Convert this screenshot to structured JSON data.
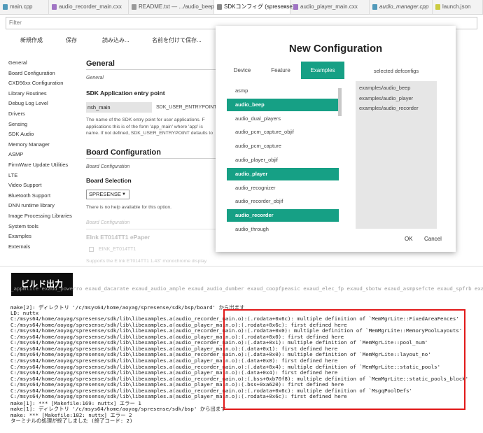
{
  "tabs": [
    {
      "label": "main.cpp",
      "icon": "cpp-file-icon",
      "color": "#519aba"
    },
    {
      "label": "audio_recorder_main.cxx",
      "icon": "cxx-file-icon",
      "color": "#a074c4"
    },
    {
      "label": "README.txt — .../audio_beep",
      "icon": "text-file-icon",
      "color": "#999999"
    },
    {
      "label": "SDKコンフィグ (spresense)",
      "icon": "config-icon",
      "color": "#888888"
    },
    {
      "label": "audio_player_main.cxx",
      "icon": "cxx-file-icon",
      "color": "#a074c4"
    },
    {
      "label": "audio_manager.cpp",
      "icon": "cpp-file-icon",
      "color": "#519aba"
    },
    {
      "label": "launch.json",
      "icon": "json-file-icon",
      "color": "#cbcb41"
    }
  ],
  "filter": {
    "placeholder": "Filter"
  },
  "toolbar": {
    "new": "新規作成",
    "save": "保存",
    "load": "読み込み...",
    "save_as": "名前を付けて保存..."
  },
  "menu": [
    "General",
    "Board Configuration",
    "CXD56xx Configuration",
    "Library Routines",
    "Debug Log Level",
    "Drivers",
    "Sensing",
    "SDK Audio",
    "Memory Manager",
    "ASMP",
    "FirmWare Update Utilities",
    "LTE",
    "Video Support",
    "Bluetooth Support",
    "DNN runtime library",
    "Image Processing Libraries",
    "System tools",
    "Examples",
    "Externals"
  ],
  "content": {
    "general_title": "General",
    "general_sub": "General",
    "entry_title": "SDK Application entry point",
    "entry_value": "nsh_main",
    "entry_key": "SDK_USER_ENTRYPOINT",
    "entry_desc1": "The name of the SDK entry point for user applications. F",
    "entry_desc2": "applications this is of the form 'app_main' where 'app' is",
    "entry_desc3": "name. If not defined, SDK_USER_ENTRYPOINT defaults to",
    "board_title": "Board Configuration",
    "board_sub": "Board Configuration",
    "board_sel_title": "Board Selection",
    "board_sel_value": "SPRESENSE",
    "board_help": "There is no help available for this option.",
    "board_sub2": "Board Configuration",
    "eink_title": "EInk ET014TT1 ePaper",
    "eink_key": "EINK_ET014TT1",
    "eink_desc": "Supports the E Ink ET014TT1 1.43\" monochrome display."
  },
  "modal": {
    "title": "New Configuration",
    "tabs": [
      "Device",
      "Feature",
      "Examples"
    ],
    "active_tab": "Examples",
    "selected_header": "selected defconfigs",
    "list": [
      {
        "label": "asmp",
        "selected": false
      },
      {
        "label": "audio_beep",
        "selected": true
      },
      {
        "label": "audio_dual_players",
        "selected": false
      },
      {
        "label": "audio_pcm_capture_objif",
        "selected": false
      },
      {
        "label": "audio_pcm_capture",
        "selected": false
      },
      {
        "label": "audio_player_objif",
        "selected": false
      },
      {
        "label": "audio_player",
        "selected": true
      },
      {
        "label": "audio_recognizer",
        "selected": false
      },
      {
        "label": "audio_recorder_objif",
        "selected": false
      },
      {
        "label": "audio_recorder",
        "selected": true
      },
      {
        "label": "audio_through",
        "selected": false
      }
    ],
    "selected": [
      "examples/audio_beep",
      "examples/audio_player",
      "examples/audio_recorder"
    ],
    "ok": "OK",
    "cancel": "Cancel"
  },
  "output": {
    "title": "ビルド出力",
    "top_partial": "_appmlite exaud_powerro exaud_dacarate exaud_audio_ample exaud_audio_dumber exaud_coopfpeasic exaud_elec_fp exaud_sbotw exaud_asmpsefcte exaud_spfrb exaud_s",
    "lines": [
      "make[2]: ディレクトリ '/c/msys64/home/aoyag/spresense/sdk/bsp/board' から出ます",
      "LD: nuttx",
      "C:/msys64/home/aoyag/spresense/sdk/lib\\libexamples.a(audio_recorder_main.o):(.rodata+0x6c): multiple definition of `MemMgrLite::FixedAreaFences'",
      "C:/msys64/home/aoyag/spresense/sdk/lib\\libexamples.a(audio_player_main.o):(.rodata+0x6c): first defined here",
      "C:/msys64/home/aoyag/spresense/sdk/lib\\libexamples.a(audio_recorder_main.o):(.rodata+0x0): multiple definition of `MemMgrLite::MemoryPoolLayouts'",
      "C:/msys64/home/aoyag/spresense/sdk/lib\\libexamples.a(audio_player_main.o):(.rodata+0x0): first defined here",
      "C:/msys64/home/aoyag/spresense/sdk/lib\\libexamples.a(audio_recorder_main.o):(.data+0x1): multiple definition of `MemMgrLite::pool_num'",
      "C:/msys64/home/aoyag/spresense/sdk/lib\\libexamples.a(audio_player_main.o):(.data+0x1): first defined here",
      "C:/msys64/home/aoyag/spresense/sdk/lib\\libexamples.a(audio_recorder_main.o):(.data+0x0): multiple definition of `MemMgrLite::layout_no'",
      "C:/msys64/home/aoyag/spresense/sdk/lib\\libexamples.a(audio_player_main.o):(.data+0x0): first defined here",
      "C:/msys64/home/aoyag/spresense/sdk/lib\\libexamples.a(audio_recorder_main.o):(.data+0x4): multiple definition of `MemMgrLite::static_pools'",
      "C:/msys64/home/aoyag/spresense/sdk/lib\\libexamples.a(audio_player_main.o):(.data+0x4): first defined here",
      "C:/msys64/home/aoyag/spresense/sdk/lib\\libexamples.a(audio_recorder_main.o):(.bss+0xb70f8): multiple definition of `MemMgrLite::static_pools_block'",
      "C:/msys64/home/aoyag/spresense/sdk/lib\\libexamples.a(audio_player_main.o):(.bss+0xa620): first defined here",
      "C:/msys64/home/aoyag/spresense/sdk/lib\\libexamples.a(audio_recorder_main.o):(.rodata+0x6c): multiple definition of `MsgqPoolDefs'",
      "C:/msys64/home/aoyag/spresense/sdk/lib\\libexamples.a(audio_player_main.o):(.rodata+0x6c): first defined here",
      "make[1]: *** [Makefile:169: nuttx] エラー 1",
      "make[1]: ディレクトリ '/c/msys64/home/aoyag/spresense/sdk/bsp' から出ます",
      "make: *** [Makefile:182: nuttx] エラー 2",
      "ターミナルの処理が終了しました (終了コード: 2)"
    ]
  },
  "colors": {
    "accent": "#16a085",
    "highlight": "#e11919"
  }
}
